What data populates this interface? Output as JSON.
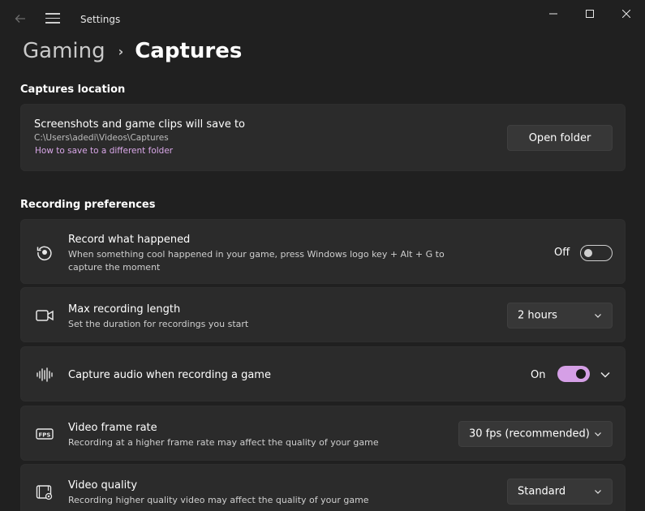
{
  "window": {
    "title": "Settings"
  },
  "breadcrumb": {
    "parent": "Gaming",
    "separator": "›",
    "current": "Captures"
  },
  "captures_location": {
    "heading": "Captures location",
    "title": "Screenshots and game clips will save to",
    "path": "C:\\Users\\adedi\\Videos\\Captures",
    "link": "How to save to a different folder",
    "button": "Open folder"
  },
  "recording": {
    "heading": "Recording preferences",
    "record_what_happened": {
      "icon": "record-history-icon",
      "title": "Record what happened",
      "desc_line1": "When something cool happened in your game, press Windows logo key + Alt + G to",
      "desc_line2": "capture the moment",
      "state_label": "Off",
      "state": false
    },
    "max_length": {
      "icon": "video-camera-icon",
      "title": "Max recording length",
      "desc": "Set the duration for recordings you start",
      "value": "2 hours"
    },
    "capture_audio": {
      "icon": "audio-waveform-icon",
      "title": "Capture audio when recording a game",
      "state_label": "On",
      "state": true
    },
    "frame_rate": {
      "icon": "fps-icon",
      "title": "Video frame rate",
      "desc": "Recording at a higher frame rate may affect the quality of your game",
      "value": "30 fps (recommended)"
    },
    "quality": {
      "icon": "video-settings-icon",
      "title": "Video quality",
      "desc": "Recording higher quality video may affect the quality of your game",
      "value": "Standard"
    }
  },
  "colors": {
    "background": "#202020",
    "card": "#2b2b2b",
    "accent": "#d59fe6",
    "link": "#d9a7e8"
  }
}
